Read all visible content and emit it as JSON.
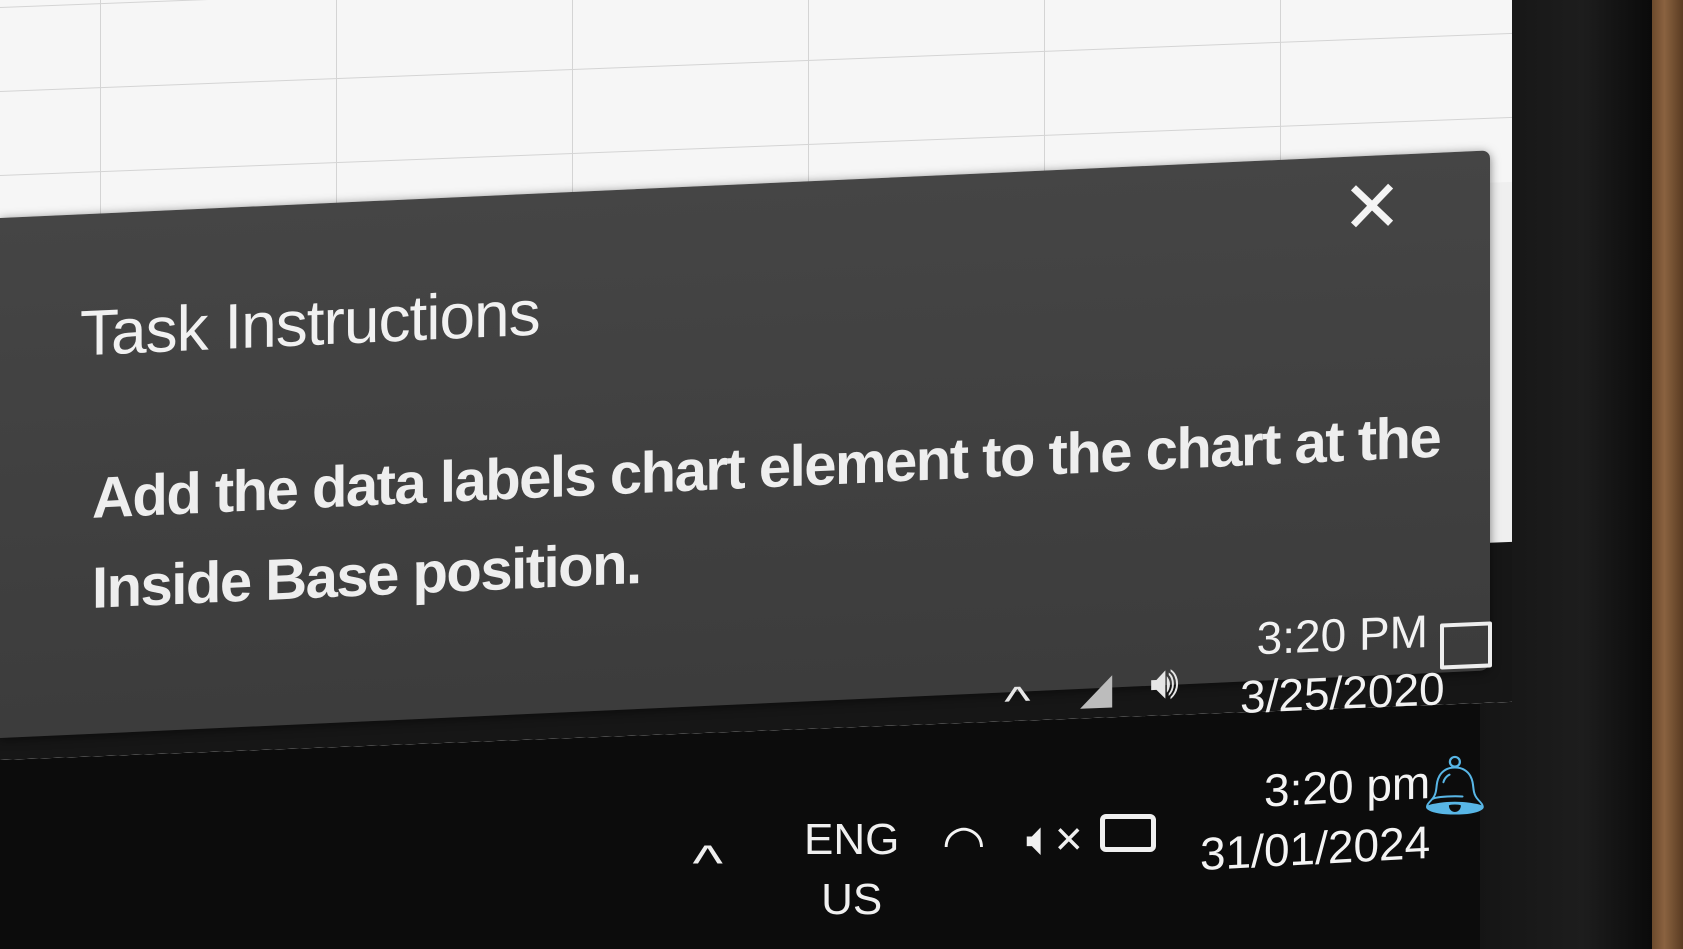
{
  "toast": {
    "title": "Task Instructions",
    "close_icon": "close-icon",
    "message": "Add the data labels chart element to the chart at the Inside Base position."
  },
  "old_taskbar": {
    "chevron_icon": "chevron-up-icon",
    "network_icon": "network-icon",
    "volume_icon": "volume-icon",
    "time": "3:20 PM",
    "date": "3/25/2020",
    "action_center_icon": "action-center-icon"
  },
  "laptop_taskbar": {
    "chevron_icon": "chevron-up-icon",
    "language": "ENG",
    "region": "US",
    "wifi_icon": "wifi-icon",
    "mute_icon": "volume-muted-icon",
    "battery_icon": "battery-icon",
    "time": "3:20 pm",
    "date": "31/01/2024",
    "notification_icon": "bell-icon",
    "notification_color": "#58b6e6"
  }
}
